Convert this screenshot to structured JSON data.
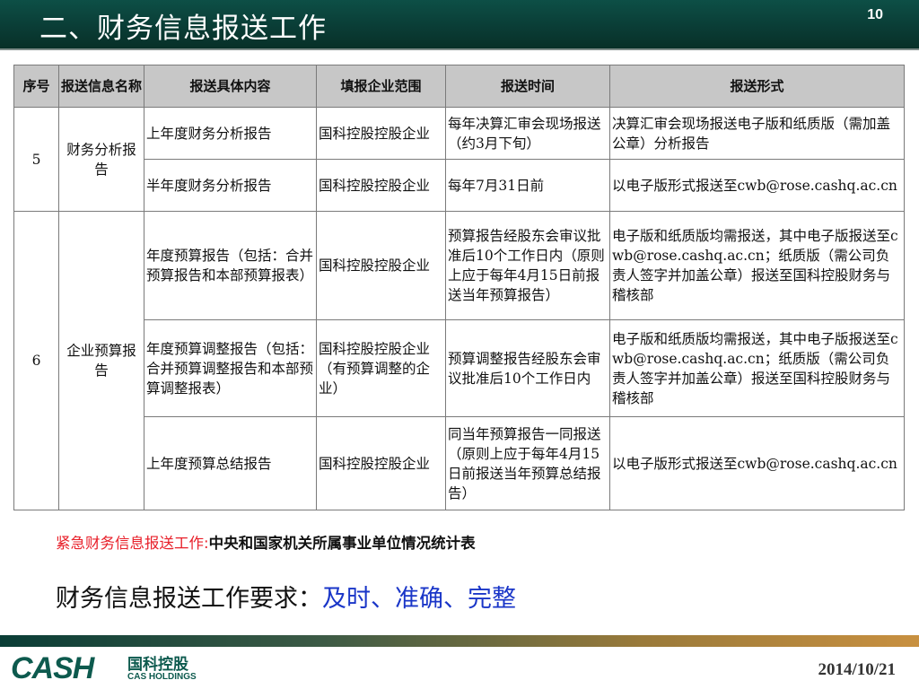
{
  "header": {
    "title": "二、财务信息报送工作",
    "page_number": "10"
  },
  "table": {
    "columns": [
      "序号",
      "报送信息名称",
      "报送具体内容",
      "填报企业范围",
      "报送时间",
      "报送形式"
    ],
    "groups": [
      {
        "index": "5",
        "name": "财务分析报告",
        "rows": [
          {
            "content": "上年度财务分析报告",
            "scope": "国科控股控股企业",
            "time": "每年决算汇审会现场报送（约3月下旬）",
            "form": "决算汇审会现场报送电子版和纸质版（需加盖公章）分析报告"
          },
          {
            "content": "半年度财务分析报告",
            "scope": "国科控股控股企业",
            "time": "每年7月31日前",
            "form": "以电子版形式报送至cwb@rose.cashq.ac.cn"
          }
        ]
      },
      {
        "index": "6",
        "name": "企业预算报告",
        "rows": [
          {
            "content": "年度预算报告（包括：合并预算报告和本部预算报表）",
            "scope": "国科控股控股企业",
            "time": "预算报告经股东会审议批准后10个工作日内（原则上应于每年4月15日前报送当年预算报告）",
            "form": "电子版和纸质版均需报送，其中电子版报送至cwb@rose.cashq.ac.cn；纸质版（需公司负责人签字并加盖公章）报送至国科控股财务与稽核部"
          },
          {
            "content": "年度预算调整报告（包括：合并预算调整报告和本部预算调整报表）",
            "scope": "国科控股控股企业（有预算调整的企业）",
            "time": "预算调整报告经股东会审议批准后10个工作日内",
            "form": "电子版和纸质版均需报送，其中电子版报送至cwb@rose.cashq.ac.cn；纸质版（需公司负责人签字并加盖公章）报送至国科控股财务与稽核部"
          },
          {
            "content": "上年度预算总结报告",
            "scope": "国科控股控股企业",
            "time": "同当年预算报告一同报送（原则上应于每年4月15日前报送当年预算总结报告）",
            "form": "以电子版形式报送至cwb@rose.cashq.ac.cn"
          }
        ]
      }
    ]
  },
  "urgent": {
    "label": "紧急财务信息报送工作:",
    "text": "中央和国家机关所属事业单位情况统计表"
  },
  "requirement": {
    "label": "财务信息报送工作要求：",
    "value": "及时、准确、完整"
  },
  "footer": {
    "logo_mark": "CASH",
    "logo_cn": "国科控股",
    "logo_en": "CAS HOLDINGS",
    "date": "2014/10/21"
  },
  "colors": {
    "header_bg": "#0a3d36",
    "urgent_red": "#e8202a",
    "requirement_blue": "#1a36c8",
    "table_header_bg": "#c7c7c7"
  }
}
